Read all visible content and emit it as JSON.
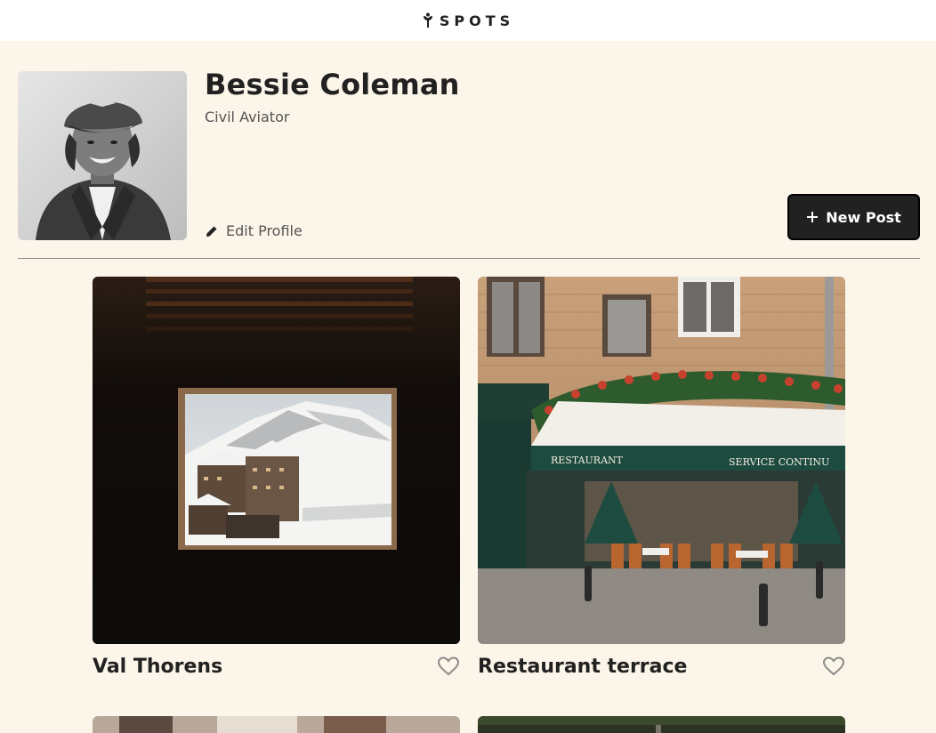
{
  "header": {
    "logo_text": "SPOTS",
    "logo_icon": "sprout-icon"
  },
  "profile": {
    "name": "Bessie Coleman",
    "description": "Civil Aviator",
    "edit_label": "Edit Profile",
    "edit_icon": "pencil-icon",
    "new_post_label": "New Post",
    "new_post_icon": "plus-icon"
  },
  "cards": [
    {
      "title": "Val Thorens",
      "liked": false,
      "like_icon": "heart-outline-icon"
    },
    {
      "title": "Restaurant terrace",
      "liked": false,
      "like_icon": "heart-outline-icon"
    }
  ],
  "colors": {
    "background": "#fcf5e9",
    "header": "#ffffff",
    "text": "#212121",
    "muted": "#555555",
    "button": "#212121"
  }
}
